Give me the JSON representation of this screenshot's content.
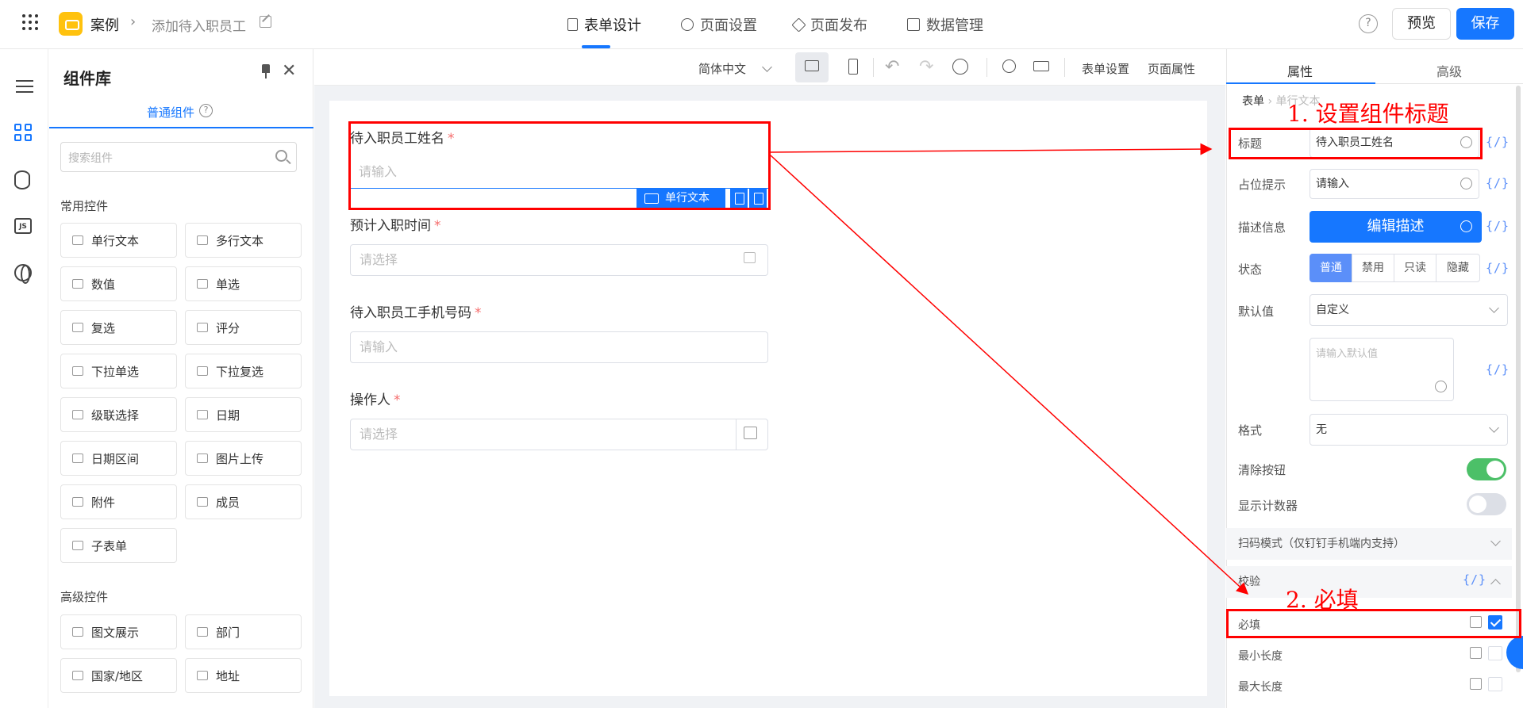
{
  "header": {
    "app_name": "案例",
    "page_name": "添加待入职员工",
    "tabs": [
      {
        "label": "表单设计",
        "icon": "form-icon",
        "active": true
      },
      {
        "label": "页面设置",
        "icon": "gear-icon"
      },
      {
        "label": "页面发布",
        "icon": "send-icon"
      },
      {
        "label": "数据管理",
        "icon": "table-icon"
      }
    ],
    "help": "?",
    "preview_label": "预览",
    "save_label": "保存"
  },
  "library": {
    "title": "组件库",
    "tab_label": "普通组件",
    "search_placeholder": "搜索组件",
    "group_common": "常用控件",
    "common": [
      "单行文本",
      "多行文本",
      "数值",
      "单选",
      "复选",
      "评分",
      "下拉单选",
      "下拉复选",
      "级联选择",
      "日期",
      "日期区间",
      "图片上传",
      "附件",
      "成员",
      "子表单"
    ],
    "group_advanced": "高级控件",
    "advanced": [
      "图文展示",
      "部门",
      "国家/地区",
      "地址"
    ]
  },
  "toolbar": {
    "language": "简体中文",
    "form_settings": "表单设置",
    "page_props": "页面属性"
  },
  "form": {
    "fields": [
      {
        "label": "待入职员工姓名",
        "required": "*",
        "placeholder": "请输入"
      },
      {
        "label": "预计入职时间",
        "required": "*",
        "placeholder": "请选择"
      },
      {
        "label": "待入职员工手机号码",
        "required": "*",
        "placeholder": "请输入"
      },
      {
        "label": "操作人",
        "required": "*",
        "placeholder": "请选择"
      }
    ],
    "selected_tag": "单行文本"
  },
  "props": {
    "tab_props": "属性",
    "tab_advanced": "高级",
    "crumb_root": "表单",
    "crumb_leaf": "单行文本",
    "fx": "{/}",
    "title_label": "标题",
    "title_value": "待入职员工姓名",
    "placeholder_label": "占位提示",
    "placeholder_value": "请输入",
    "desc_label": "描述信息",
    "desc_button": "编辑描述",
    "state_label": "状态",
    "states": [
      "普通",
      "禁用",
      "只读",
      "隐藏"
    ],
    "default_label": "默认值",
    "default_value": "自定义",
    "default_ph": "请输入默认值",
    "format_label": "格式",
    "format_value": "无",
    "clear_label": "清除按钮",
    "counter_label": "显示计数器",
    "scan_section": "扫码模式（仅钉钉手机端内支持）",
    "validate_section": "校验",
    "required_label": "必填",
    "min_label": "最小长度",
    "max_label": "最大长度"
  },
  "annotations": {
    "step1": "1. 设置组件标题",
    "step2": "2. 必填"
  }
}
